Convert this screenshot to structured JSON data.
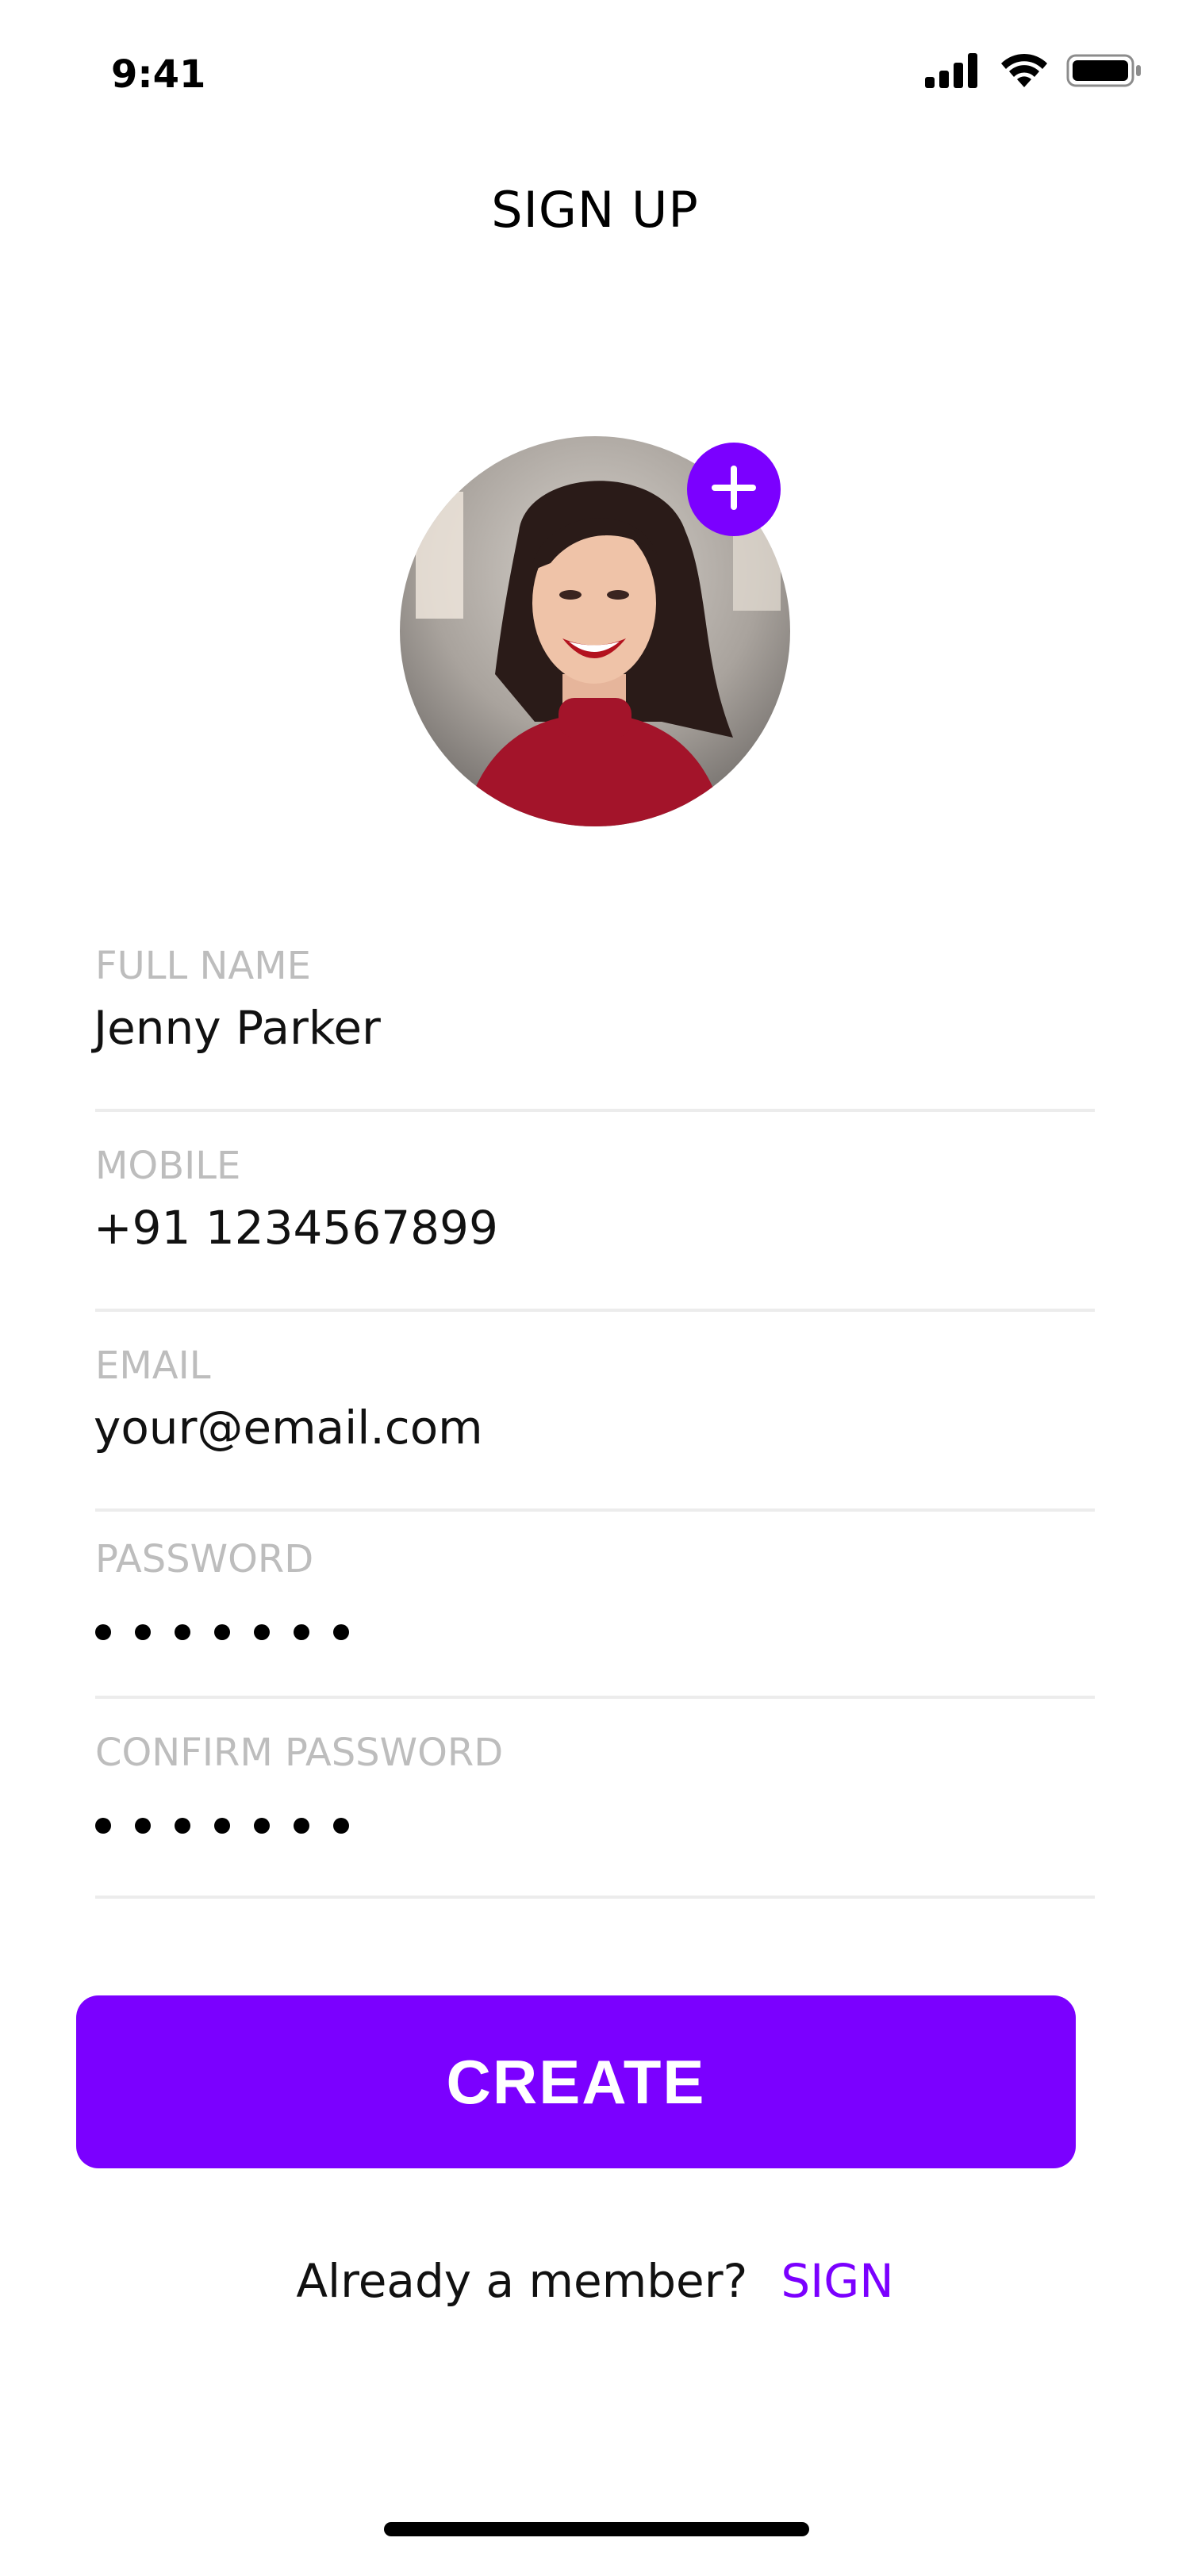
{
  "status_bar": {
    "time": "9:41",
    "icons": [
      "signal-icon",
      "wifi-icon",
      "battery-icon"
    ]
  },
  "header": {
    "title": "SIGN UP"
  },
  "avatar": {
    "add_icon": "plus-icon",
    "accent_color": "#7B00FF"
  },
  "form": {
    "full_name": {
      "label": "FULL NAME",
      "value": "Jenny Parker"
    },
    "mobile": {
      "label": "MOBILE",
      "value": "+91 1234567899"
    },
    "email": {
      "label": "EMAIL",
      "value": "your@email.com"
    },
    "password": {
      "label": "PASSWORD",
      "masked_length": 7
    },
    "confirm_password": {
      "label": "CONFIRM PASSWORD",
      "masked_length": 7
    }
  },
  "actions": {
    "create_label": "CREATE"
  },
  "footer": {
    "prompt": "Already a member?",
    "link_label": "SIGN"
  },
  "colors": {
    "accent": "#7B00FF",
    "label_gray": "#BDBDBD",
    "divider": "#ECECEC"
  }
}
